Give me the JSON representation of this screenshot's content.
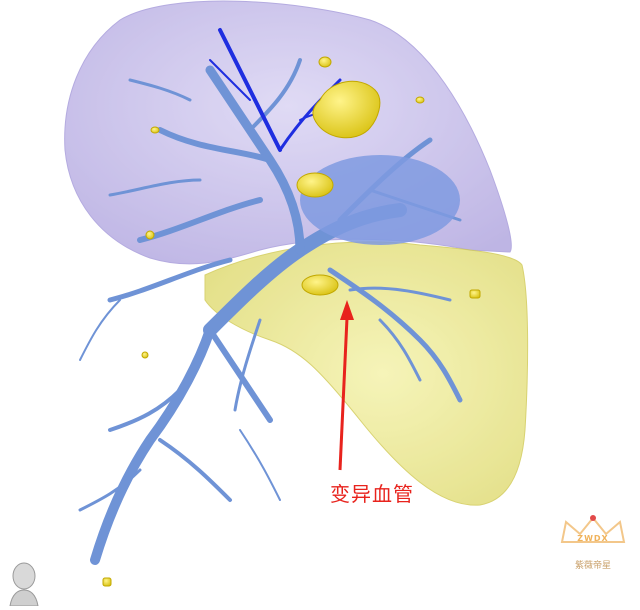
{
  "annotation": {
    "label": "变异血管",
    "color": "#e8231d"
  },
  "watermark": {
    "code": "ZWDX",
    "name": "紫薇帝星"
  },
  "colors": {
    "upper_lobe": "#b9aee6",
    "lower_lobe": "#ecea8a",
    "vessel": "#6f93d6",
    "vein_dark": "#1f2ee0",
    "lymph_node": "#f3e23a"
  },
  "icons": [
    "orientation-head-icon",
    "crown-icon",
    "annotation-arrow-icon"
  ]
}
